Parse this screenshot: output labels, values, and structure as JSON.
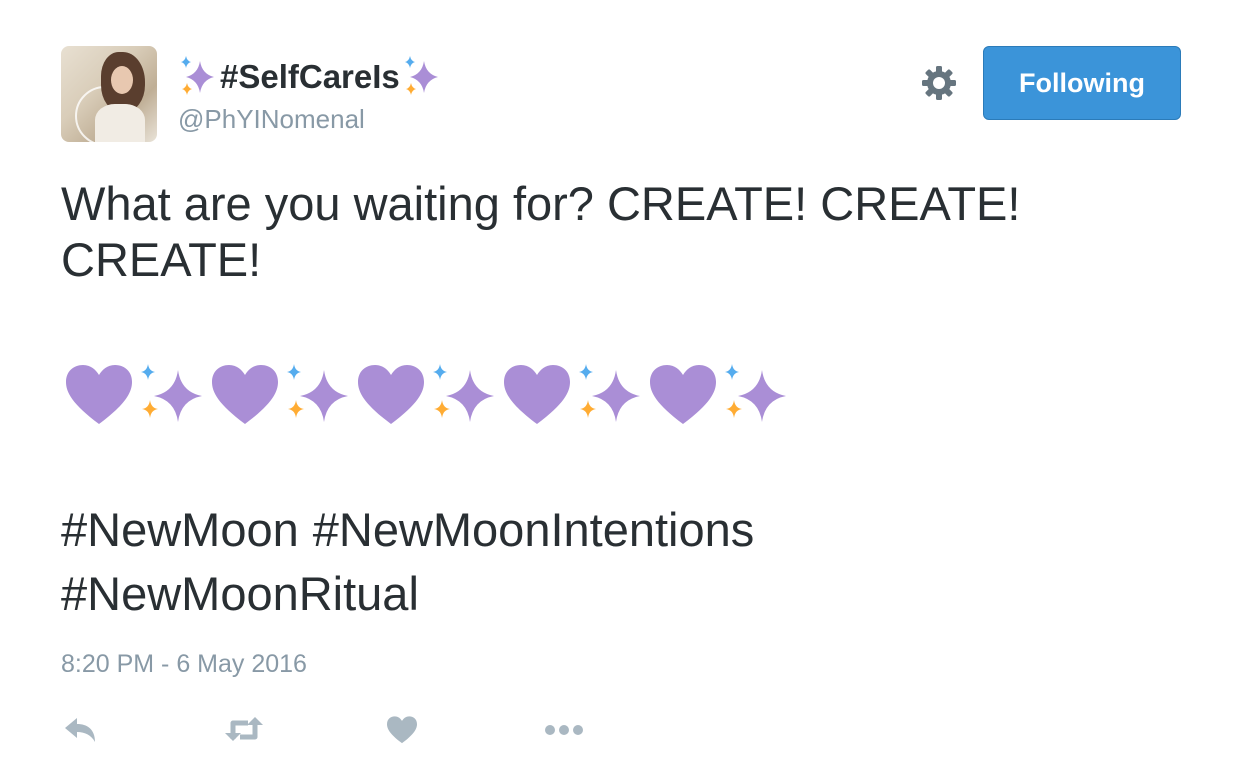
{
  "tweet": {
    "author": {
      "display_name": "#SelfCareIs",
      "handle": "@PhYINomenal",
      "avatar": "profile-photo"
    },
    "follow_button_label": "Following",
    "settings_icon": "gear-icon",
    "text_line": "What are you waiting for? CREATE! CREATE! CREATE!",
    "emoji_sequence": [
      "purple-heart",
      "sparkles",
      "purple-heart",
      "sparkles",
      "purple-heart",
      "sparkles",
      "purple-heart",
      "sparkles",
      "purple-heart",
      "sparkles"
    ],
    "hashtags": [
      "#NewMoon",
      "#NewMoonIntentions",
      "#NewMoonRitual"
    ],
    "timestamp": "8:20 PM - 6 May 2016",
    "actions": [
      "reply-icon",
      "retweet-icon",
      "like-icon",
      "more-icon"
    ]
  },
  "colors": {
    "accent": "#3b94d9",
    "text": "#292f33",
    "muted": "#8899a6",
    "purple": "#aa8ed6",
    "sparkle_blue": "#55acee",
    "sparkle_orange": "#ffac33"
  }
}
